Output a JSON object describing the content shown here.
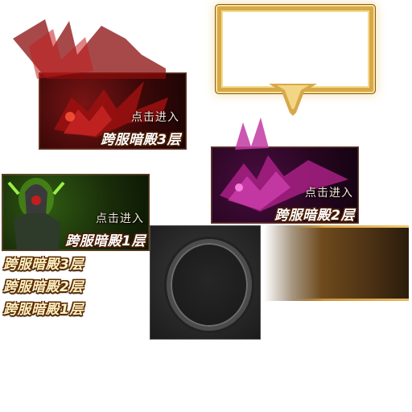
{
  "banners": [
    {
      "enter_label": "点击进入",
      "title": "跨服暗殿3层"
    },
    {
      "enter_label": "点击进入",
      "title": "跨服暗殿2层"
    },
    {
      "enter_label": "点击进入",
      "title": "跨服暗殿1层"
    }
  ],
  "floor_labels": [
    "跨服暗殿3层",
    "跨服暗殿2层",
    "跨服暗殿1层"
  ],
  "colors": {
    "banner3_accent": "#b01a1a",
    "banner2_accent": "#c02a9a",
    "banner1_accent": "#3f8a22",
    "gold": "#d7a84a"
  },
  "icons": {
    "banner3_art": "red-dragon-icon",
    "banner2_art": "magenta-dragon-icon",
    "banner1_art": "green-armored-knight-icon",
    "frame": "gold-frame-icon",
    "ring": "dark-ring-frame-icon"
  }
}
